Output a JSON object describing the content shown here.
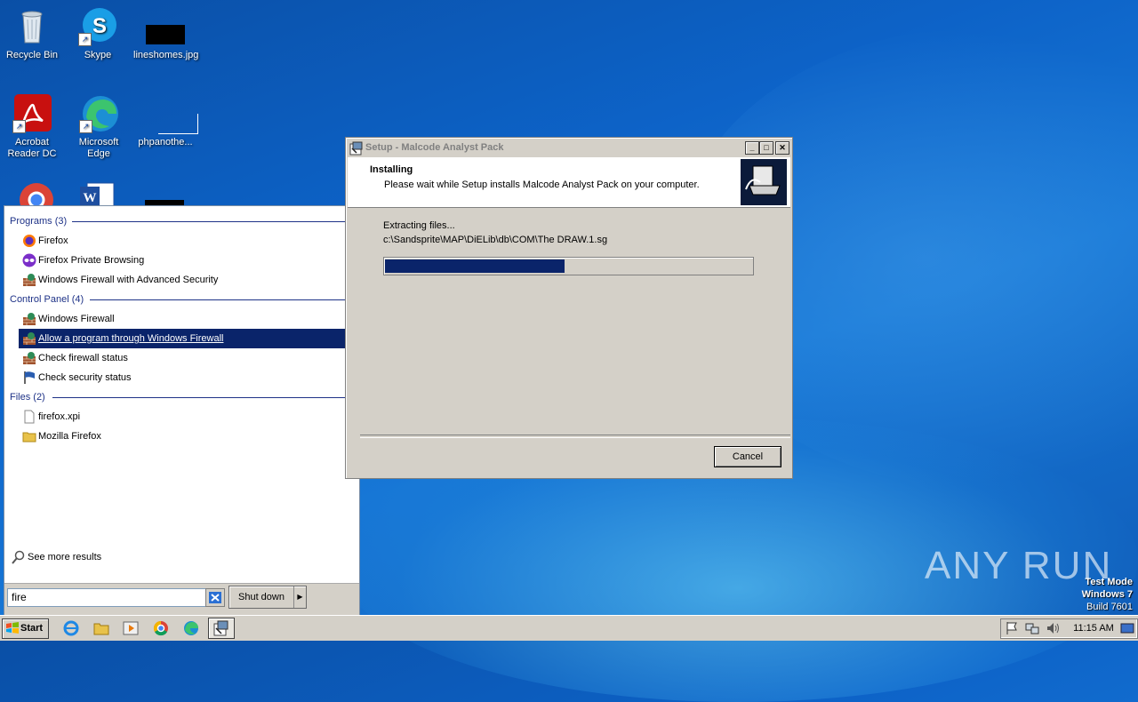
{
  "desktop": {
    "icons": [
      {
        "label": "Recycle Bin",
        "icon": "recycle-bin-icon"
      },
      {
        "label": "Skype",
        "icon": "skype-icon"
      },
      {
        "label": "lineshomes.jpg",
        "icon": "image-file-icon"
      },
      {
        "label": "Acrobat Reader DC",
        "icon": "acrobat-icon"
      },
      {
        "label": "Microsoft Edge",
        "icon": "edge-icon"
      },
      {
        "label": "phpanothe...",
        "icon": "file-icon"
      }
    ]
  },
  "start_menu": {
    "groups": [
      {
        "label": "Programs (3)",
        "items": [
          {
            "label": "Firefox",
            "icon": "firefox-icon"
          },
          {
            "label": "Firefox Private Browsing",
            "icon": "private-browsing-icon"
          },
          {
            "label": "Windows Firewall with Advanced Security",
            "icon": "firewall-icon"
          }
        ]
      },
      {
        "label": "Control Panel (4)",
        "items": [
          {
            "label": "Windows Firewall",
            "icon": "firewall-icon"
          },
          {
            "label": "Allow a program through Windows Firewall",
            "icon": "firewall-icon",
            "selected": true
          },
          {
            "label": "Check firewall status",
            "icon": "firewall-icon"
          },
          {
            "label": "Check security status",
            "icon": "flag-icon"
          }
        ]
      },
      {
        "label": "Files (2)",
        "items": [
          {
            "label": "firefox.xpi",
            "icon": "file-icon"
          },
          {
            "label": "Mozilla Firefox",
            "icon": "folder-icon"
          }
        ]
      }
    ],
    "see_more": "See more results",
    "search_value": "fire",
    "shutdown_label": "Shut down"
  },
  "dialog": {
    "title": "Setup - Malcode Analyst Pack",
    "header_title": "Installing",
    "header_subtitle": "Please wait while Setup installs Malcode Analyst Pack on your computer.",
    "status": "Extracting files...",
    "current_file": "c:\\Sandsprite\\MAP\\DiELib\\db\\COM\\The DRAW.1.sg",
    "progress": 0.49,
    "cancel_label": "Cancel",
    "accent": "#0a246a"
  },
  "taskbar": {
    "start_label": "Start",
    "pinned": [
      "ie-icon",
      "explorer-icon",
      "media-player-icon",
      "chrome-icon",
      "edge-icon",
      "setup-icon"
    ],
    "clock": "11:15 AM"
  },
  "watermark": {
    "text": "ANY RUN",
    "test_mode": "Test Mode",
    "os": "Windows 7",
    "build": "Build 7601"
  }
}
